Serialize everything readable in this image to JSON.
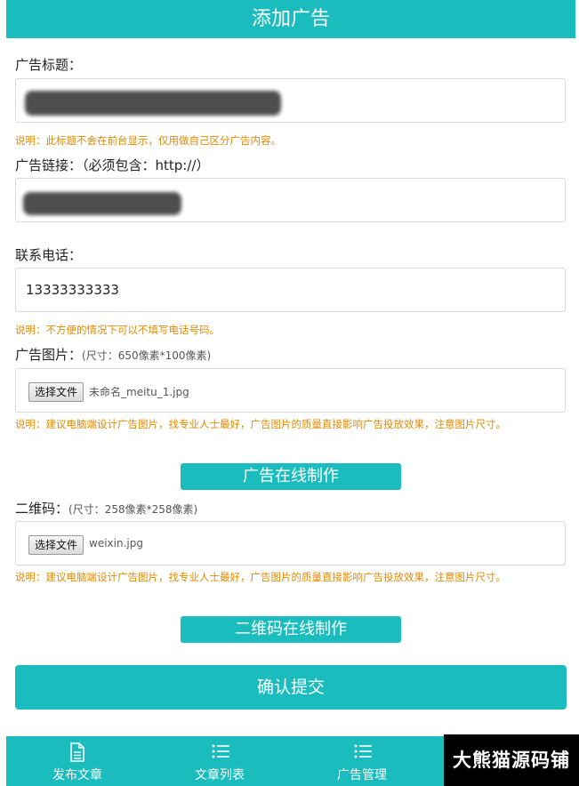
{
  "header": {
    "title": "添加广告"
  },
  "form": {
    "ad_title": {
      "label": "广告标题：",
      "note": "说明：此标题不会在前台显示，仅用做自己区分广告内容。"
    },
    "ad_link": {
      "label": "广告链接：（必须包含：http://）"
    },
    "phone": {
      "label": "联系电话：",
      "value": "13333333333",
      "note": "说明：不方便的情况下可以不填写电话号码。"
    },
    "ad_image": {
      "label": "广告图片：",
      "size_hint": "(尺寸：650像素*100像素)",
      "file_button": "选择文件",
      "file_name": "未命名_meitu_1.jpg",
      "note": "说明：建议电脑端设计广告图片，找专业人士最好，广告图片的质量直接影响广告投放效果，注意图片尺寸。",
      "online_button": "广告在线制作"
    },
    "qrcode": {
      "label": "二维码：",
      "size_hint": "(尺寸：258像素*258像素)",
      "file_button": "选择文件",
      "file_name": "weixin.jpg",
      "note": "说明：建议电脑端设计广告图片，找专业人士最好，广告图片的质量直接影响广告投放效果，注意图片尺寸。",
      "online_button": "二维码在线制作"
    },
    "submit": "确认提交"
  },
  "bottom_nav": [
    {
      "label": "发布文章",
      "icon": "document-icon"
    },
    {
      "label": "文章列表",
      "icon": "list-icon"
    },
    {
      "label": "广告管理",
      "icon": "list-icon"
    }
  ],
  "watermark": "大熊猫源码铺",
  "colors": {
    "accent": "#1bbcbd",
    "note": "#e08a00"
  }
}
